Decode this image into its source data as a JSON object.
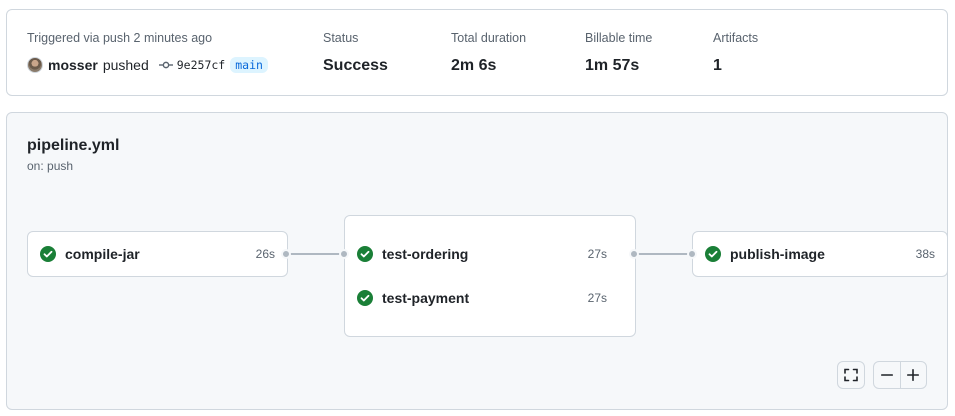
{
  "summary": {
    "trigger_label": "Triggered via push 2 minutes ago",
    "actor": "mosser",
    "action": "pushed",
    "commit_sha": "9e257cf",
    "branch": "main",
    "stats": [
      {
        "label": "Status",
        "value": "Success"
      },
      {
        "label": "Total duration",
        "value": "2m 6s"
      },
      {
        "label": "Billable time",
        "value": "1m 57s"
      },
      {
        "label": "Artifacts",
        "value": "1"
      }
    ]
  },
  "workflow": {
    "name": "pipeline.yml",
    "trigger": "on: push",
    "jobs": [
      {
        "name": "compile-jar",
        "duration": "26s",
        "status": "success"
      },
      {
        "name": "test-ordering",
        "duration": "27s",
        "status": "success"
      },
      {
        "name": "test-payment",
        "duration": "27s",
        "status": "success"
      },
      {
        "name": "publish-image",
        "duration": "38s",
        "status": "success"
      }
    ]
  },
  "colors": {
    "success": "#1a7f37",
    "branch_bg": "#ddf4ff",
    "branch_fg": "#0969da",
    "connector": "#afb8c1"
  },
  "icons": {
    "check": "check-circle-fill-icon",
    "commit": "git-commit-icon",
    "fullscreen": "screen-full-icon",
    "zoom_out": "dash-icon",
    "zoom_in": "plus-icon"
  }
}
